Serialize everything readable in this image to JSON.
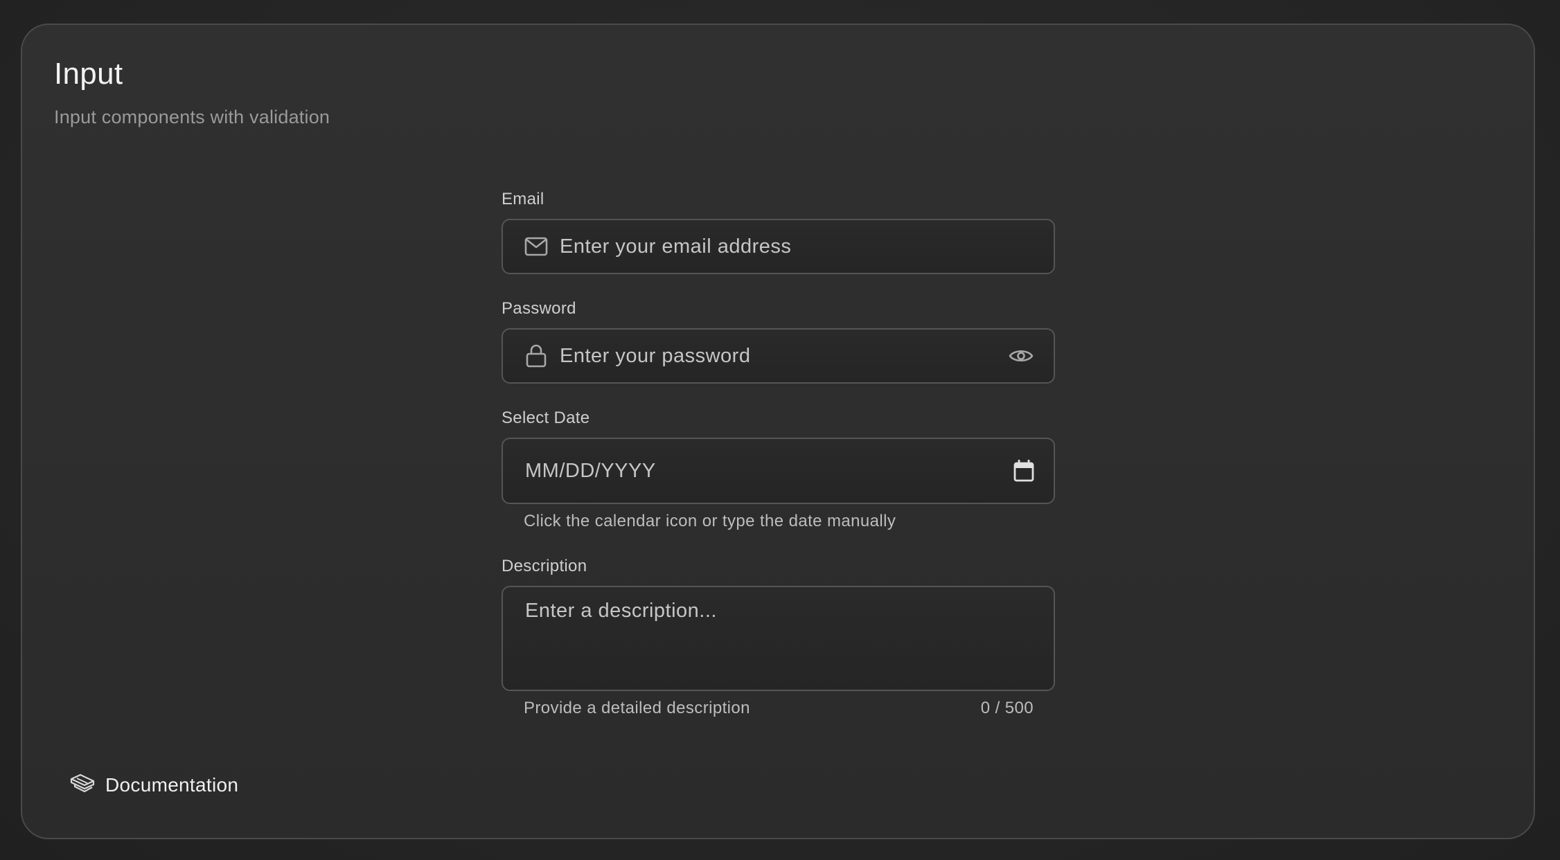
{
  "header": {
    "title": "Input",
    "subtitle": "Input components with validation"
  },
  "form": {
    "email": {
      "label": "Email",
      "placeholder": "Enter your email address",
      "value": "",
      "icon": "mail-icon"
    },
    "password": {
      "label": "Password",
      "placeholder": "Enter your password",
      "value": "",
      "icon": "lock-icon",
      "toggle_icon": "eye-icon"
    },
    "date": {
      "label": "Select Date",
      "placeholder": "MM/DD/YYYY",
      "value": "",
      "icon": "calendar-icon",
      "helper": "Click the calendar icon or type the date manually"
    },
    "description": {
      "label": "Description",
      "placeholder": "Enter a description...",
      "value": "",
      "helper": "Provide a detailed description",
      "counter": "0 / 500"
    }
  },
  "footer": {
    "documentation_label": "Documentation",
    "documentation_icon": "book-icon"
  },
  "colors": {
    "background": "#262626",
    "card": "#2e2e2e",
    "border": "#555555",
    "text_primary": "#f2f2f2",
    "text_secondary": "#9a9a9a"
  }
}
